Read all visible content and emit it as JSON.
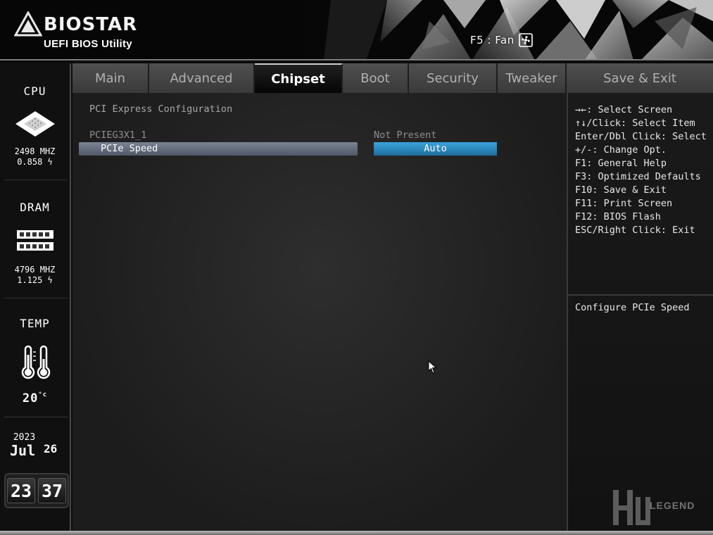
{
  "header": {
    "brand": "BIOSTAR",
    "subtitle": "UEFI BIOS Utility",
    "fan_shortcut": "F5 : Fan"
  },
  "sidebar": {
    "cpu": {
      "title": "CPU",
      "freq": "2498 MHZ",
      "volt": "0.858"
    },
    "dram": {
      "title": "DRAM",
      "freq": "4796 MHZ",
      "volt": "1.125"
    },
    "temp": {
      "title": "TEMP",
      "value": "20",
      "unit": "°c"
    },
    "date": {
      "year": "2023",
      "month": "Jul",
      "day": "26"
    },
    "clock": {
      "hour": "23",
      "minute": "37"
    }
  },
  "tabs": [
    {
      "label": "Main"
    },
    {
      "label": "Advanced"
    },
    {
      "label": "Chipset",
      "active": true
    },
    {
      "label": "Boot"
    },
    {
      "label": "Security"
    },
    {
      "label": "Tweaker"
    },
    {
      "label": "Save & Exit"
    }
  ],
  "main": {
    "section_title": "PCI Express Configuration",
    "device_label": "PCIEG3X1_1",
    "device_value": "Not Present",
    "speed_label": "PCIe Speed",
    "speed_value": "Auto"
  },
  "help": {
    "keys": [
      "→←: Select Screen",
      "↑↓/Click: Select Item",
      "Enter/Dbl Click: Select",
      "+/-: Change Opt.",
      "F1: General Help",
      "F3: Optimized Defaults",
      "F10: Save & Exit",
      "F11: Print Screen",
      "F12: BIOS Flash",
      "ESC/Right Click: Exit"
    ],
    "description": "Configure PCIe Speed",
    "watermark": "LEGEND"
  },
  "colors": {
    "selection_bar": "#6b7585",
    "value_highlight": "#2f8fc4",
    "active_tab_bg": "#0a0a0a"
  }
}
